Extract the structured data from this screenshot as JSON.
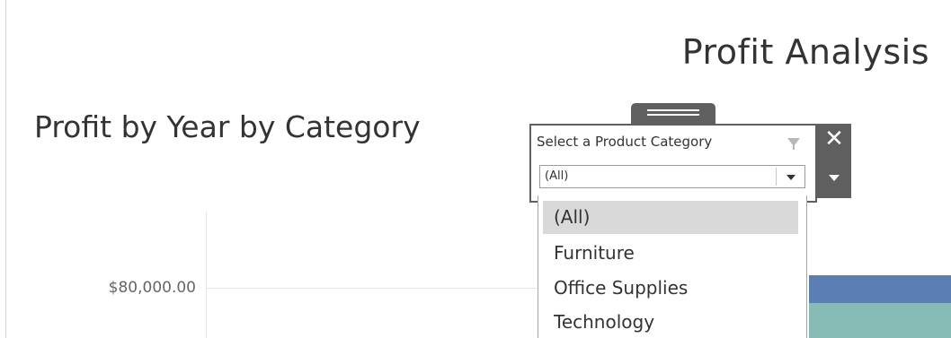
{
  "dashboard": {
    "title": "Profit Analysis"
  },
  "sheet": {
    "title": "Profit by Year by Category"
  },
  "axis": {
    "tick_label": "$80,000.00"
  },
  "filter": {
    "label": "Select a Product Category",
    "selected_value": "(All)",
    "options": [
      "(All)",
      "Furniture",
      "Office Supplies",
      "Technology"
    ],
    "highlighted_index": 0,
    "close_symbol": "✕",
    "filter_icon": "funnel-icon"
  },
  "colors": {
    "bar_blue": "#5b7fb4",
    "bar_teal": "#86bcb5",
    "card_border": "#5f5f5f"
  }
}
